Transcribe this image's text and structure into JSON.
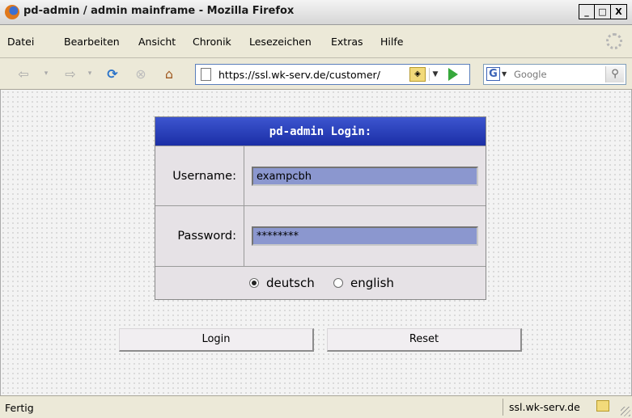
{
  "window": {
    "title": "pd-admin / admin mainframe - Mozilla Firefox",
    "controls": [
      "_",
      "□",
      "X"
    ]
  },
  "menubar": {
    "items": [
      "Datei",
      "Bearbeiten",
      "Ansicht",
      "Chronik",
      "Lesezeichen",
      "Extras",
      "Hilfe"
    ]
  },
  "navbar": {
    "url": "https://ssl.wk-serv.de/customer/",
    "search_placeholder": "Google",
    "icons": [
      "back-icon",
      "forward-icon",
      "reload-icon",
      "stop-icon",
      "home-icon",
      "page-icon",
      "lock-icon",
      "go-icon",
      "google-icon",
      "search-icon"
    ]
  },
  "login": {
    "header": "pd-admin Login:",
    "username_label": "Username:",
    "username_value": "exampcbh",
    "password_label": "Password:",
    "password_value": "********",
    "languages": [
      {
        "label": "deutsch",
        "selected": true
      },
      {
        "label": "english",
        "selected": false
      }
    ],
    "login_button": "Login",
    "reset_button": "Reset"
  },
  "statusbar": {
    "status": "Fertig",
    "domain": "ssl.wk-serv.de"
  },
  "colors": {
    "header_bg": "#2a3fbf",
    "input_bg": "#8b97cf",
    "go_arrow": "#37a83c"
  }
}
